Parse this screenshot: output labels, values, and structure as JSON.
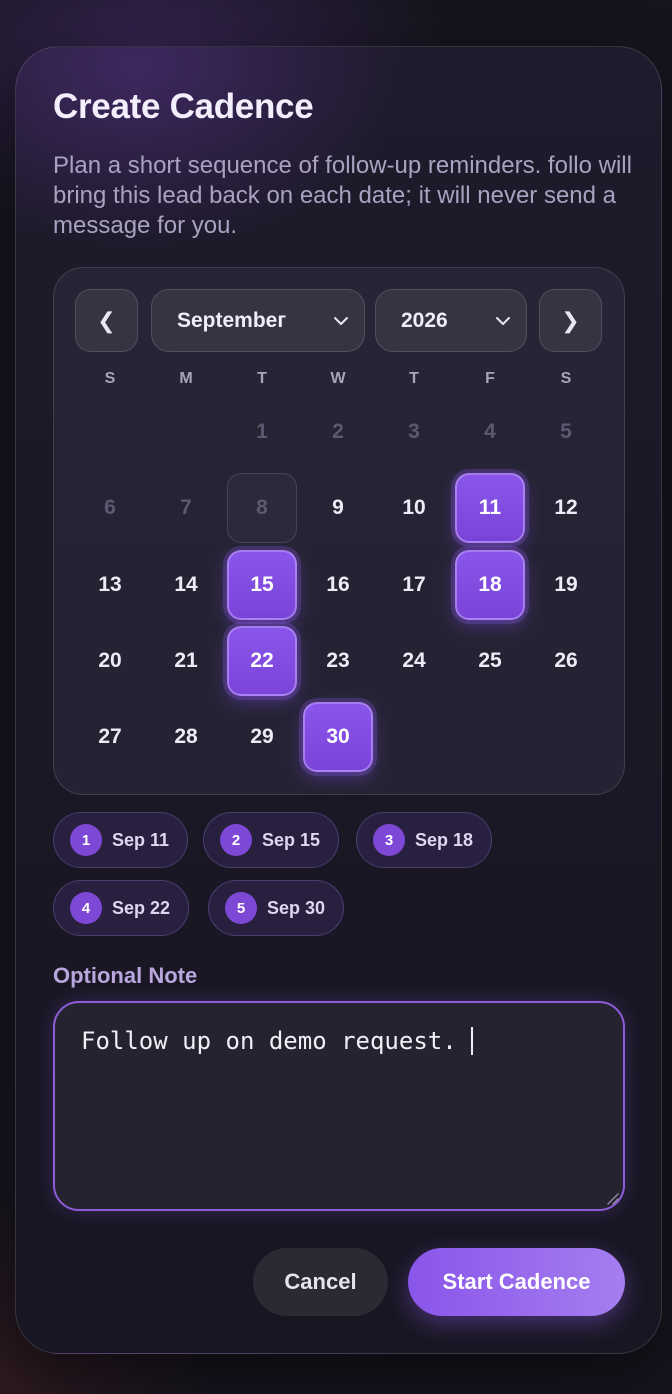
{
  "dialog": {
    "title": "Create Cadence",
    "description": "Plan a short sequence of follow-up reminders. follo will bring this lead back on each date; it will never send a message for you."
  },
  "calendar": {
    "prev_label": "❮",
    "next_label": "❯",
    "month": "Septembeг",
    "year": "2026",
    "weekdays": [
      "S",
      "M",
      "T",
      "W",
      "T",
      "F",
      "S"
    ],
    "weeks": [
      [
        "",
        "",
        "1",
        "2",
        "3",
        "4",
        "5"
      ],
      [
        "6",
        "7",
        "8",
        "9",
        "10",
        "11",
        "12"
      ],
      [
        "13",
        "14",
        "15",
        "16",
        "17",
        "18",
        "19"
      ],
      [
        "20",
        "21",
        "22",
        "23",
        "24",
        "25",
        "26"
      ],
      [
        "27",
        "28",
        "29",
        "30",
        "",
        "",
        ""
      ]
    ]
  },
  "cadence_steps": [
    {
      "index": "1",
      "date": "Sep 11"
    },
    {
      "index": "2",
      "date": "Sep 15"
    },
    {
      "index": "3",
      "date": "Sep 18"
    },
    {
      "index": "4",
      "date": "Sep 22"
    },
    {
      "index": "5",
      "date": "Sep 30"
    }
  ],
  "note": {
    "label": "Optional Note",
    "value": "Follow up on demo request."
  },
  "actions": {
    "cancel_label": "Cancel",
    "start_label": "Start Cadence"
  },
  "colors": {
    "accent": "#8a55ea",
    "accent_light": "#a57ef0",
    "background": "#16151e"
  }
}
